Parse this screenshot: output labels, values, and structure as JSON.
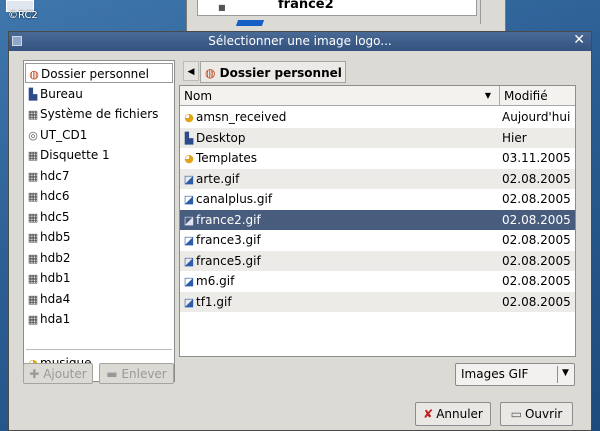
{
  "desktop": {
    "icon_label": "©RC2"
  },
  "background_window": {
    "title": "france2"
  },
  "dialog": {
    "title": "Sélectionner une image logo...",
    "close_glyph": "✕"
  },
  "places": [
    {
      "label": "Dossier personnel",
      "icon": "home-icon",
      "glyph": "◍",
      "color": "#c04010"
    },
    {
      "label": "Bureau",
      "icon": "desktop-icon",
      "glyph": "▙",
      "color": "#2d4b8a"
    },
    {
      "label": "Système de fichiers",
      "icon": "harddisk-icon",
      "glyph": "▦",
      "color": "#444444"
    },
    {
      "label": "UT_CD1",
      "icon": "cdrom-icon",
      "glyph": "◎",
      "color": "#555555"
    },
    {
      "label": "Disquette 1",
      "icon": "floppy-icon",
      "glyph": "▦",
      "color": "#444444"
    },
    {
      "label": "hdc7",
      "icon": "harddisk-icon",
      "glyph": "▦",
      "color": "#444444"
    },
    {
      "label": "hdc6",
      "icon": "harddisk-icon",
      "glyph": "▦",
      "color": "#444444"
    },
    {
      "label": "hdc5",
      "icon": "harddisk-icon",
      "glyph": "▦",
      "color": "#444444"
    },
    {
      "label": "hdb5",
      "icon": "harddisk-icon",
      "glyph": "▦",
      "color": "#444444"
    },
    {
      "label": "hdb2",
      "icon": "harddisk-icon",
      "glyph": "▦",
      "color": "#444444"
    },
    {
      "label": "hdb1",
      "icon": "harddisk-icon",
      "glyph": "▦",
      "color": "#444444"
    },
    {
      "label": "hda4",
      "icon": "harddisk-icon",
      "glyph": "▦",
      "color": "#444444"
    },
    {
      "label": "hda1",
      "icon": "harddisk-icon",
      "glyph": "▦",
      "color": "#444444"
    },
    {
      "label": "musique",
      "icon": "folder-icon",
      "glyph": "◕",
      "color": "#e3a316"
    }
  ],
  "place_buttons": {
    "add": "Ajouter",
    "remove": "Enlever"
  },
  "pathbar": {
    "current": "Dossier personnel"
  },
  "filelist": {
    "columns": {
      "name": "Nom",
      "modified": "Modifié"
    },
    "rows": [
      {
        "name": "amsn_received",
        "date": "Aujourd'hui",
        "icon": "folder-icon",
        "glyph": "◕",
        "color": "#e3a316"
      },
      {
        "name": "Desktop",
        "date": "Hier",
        "icon": "desktop-icon",
        "glyph": "▙",
        "color": "#2d4b8a"
      },
      {
        "name": "Templates",
        "date": "03.11.2005",
        "icon": "folder-icon",
        "glyph": "◕",
        "color": "#e3a316"
      },
      {
        "name": "arte.gif",
        "date": "02.08.2005",
        "icon": "image-file-icon",
        "glyph": "◪",
        "color": "#2d5da8"
      },
      {
        "name": "canalplus.gif",
        "date": "02.08.2005",
        "icon": "image-file-icon",
        "glyph": "◪",
        "color": "#2d5da8"
      },
      {
        "name": "france2.gif",
        "date": "02.08.2005",
        "icon": "image-file-icon",
        "glyph": "◪",
        "color": "#dfe6f2",
        "selected": true
      },
      {
        "name": "france3.gif",
        "date": "02.08.2005",
        "icon": "image-file-icon",
        "glyph": "◪",
        "color": "#2d5da8"
      },
      {
        "name": "france5.gif",
        "date": "02.08.2005",
        "icon": "image-file-icon",
        "glyph": "◪",
        "color": "#2d5da8"
      },
      {
        "name": "m6.gif",
        "date": "02.08.2005",
        "icon": "image-file-icon",
        "glyph": "◪",
        "color": "#2d5da8"
      },
      {
        "name": "tf1.gif",
        "date": "02.08.2005",
        "icon": "image-file-icon",
        "glyph": "◪",
        "color": "#2d5da8"
      }
    ]
  },
  "filter": {
    "selected": "Images GIF"
  },
  "buttons": {
    "cancel": "Annuler",
    "open": "Ouvrir"
  },
  "colors": {
    "selection": "#485c7e",
    "titlebar": "#3d5c88"
  }
}
